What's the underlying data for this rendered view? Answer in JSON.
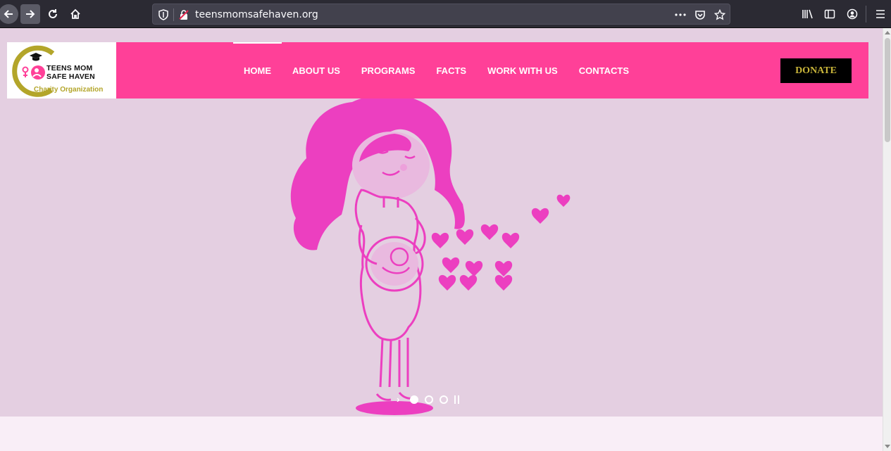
{
  "browser": {
    "url": "teensmomsafehaven.org",
    "icons": [
      "back-arrow-icon",
      "forward-arrow-icon",
      "reload-icon",
      "home-icon",
      "tracking-shield-icon",
      "insecure-lock-icon",
      "more-actions-icon",
      "pocket-icon",
      "bookmark-star-icon",
      "library-icon",
      "sidebar-icon",
      "account-icon",
      "menu-icon"
    ]
  },
  "site": {
    "logo": {
      "line1": "TEENS MOM",
      "line2": "SAFE HAVEN",
      "tagline": "Charity Organization"
    },
    "nav": [
      {
        "label": "HOME",
        "active": true
      },
      {
        "label": "ABOUT US",
        "active": false
      },
      {
        "label": "PROGRAMS",
        "active": false
      },
      {
        "label": "FACTS",
        "active": false
      },
      {
        "label": "WORK WITH US",
        "active": false
      },
      {
        "label": "CONTACTS",
        "active": false
      }
    ],
    "donate_label": "DONATE",
    "slider": {
      "slide_count": 3,
      "active_index": 0
    }
  },
  "colors": {
    "header_pink": "#ff4098",
    "illustration_pink": "#ec3fc0",
    "hero_bg": "#e4cfe1",
    "donate_text": "#c9b53a",
    "logo_olive": "#b3a52a"
  }
}
